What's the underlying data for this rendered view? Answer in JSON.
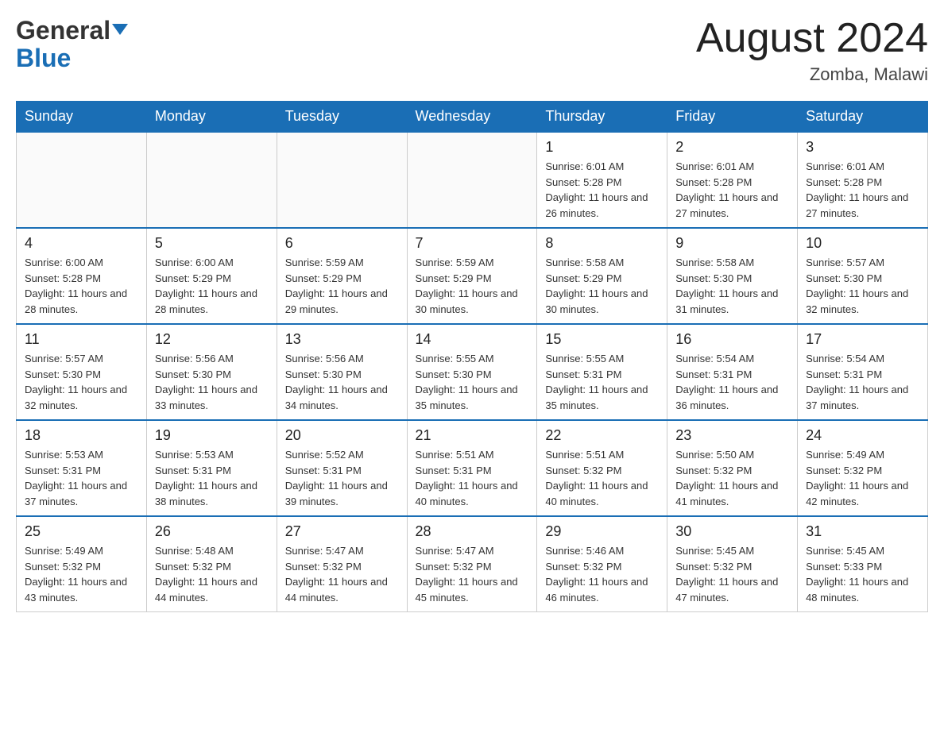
{
  "header": {
    "logo": {
      "general": "General",
      "blue": "Blue",
      "line2": "Blue"
    },
    "title": "August 2024",
    "location": "Zomba, Malawi"
  },
  "weekdays": [
    "Sunday",
    "Monday",
    "Tuesday",
    "Wednesday",
    "Thursday",
    "Friday",
    "Saturday"
  ],
  "weeks": [
    [
      {
        "day": "",
        "info": ""
      },
      {
        "day": "",
        "info": ""
      },
      {
        "day": "",
        "info": ""
      },
      {
        "day": "",
        "info": ""
      },
      {
        "day": "1",
        "info": "Sunrise: 6:01 AM\nSunset: 5:28 PM\nDaylight: 11 hours and 26 minutes."
      },
      {
        "day": "2",
        "info": "Sunrise: 6:01 AM\nSunset: 5:28 PM\nDaylight: 11 hours and 27 minutes."
      },
      {
        "day": "3",
        "info": "Sunrise: 6:01 AM\nSunset: 5:28 PM\nDaylight: 11 hours and 27 minutes."
      }
    ],
    [
      {
        "day": "4",
        "info": "Sunrise: 6:00 AM\nSunset: 5:28 PM\nDaylight: 11 hours and 28 minutes."
      },
      {
        "day": "5",
        "info": "Sunrise: 6:00 AM\nSunset: 5:29 PM\nDaylight: 11 hours and 28 minutes."
      },
      {
        "day": "6",
        "info": "Sunrise: 5:59 AM\nSunset: 5:29 PM\nDaylight: 11 hours and 29 minutes."
      },
      {
        "day": "7",
        "info": "Sunrise: 5:59 AM\nSunset: 5:29 PM\nDaylight: 11 hours and 30 minutes."
      },
      {
        "day": "8",
        "info": "Sunrise: 5:58 AM\nSunset: 5:29 PM\nDaylight: 11 hours and 30 minutes."
      },
      {
        "day": "9",
        "info": "Sunrise: 5:58 AM\nSunset: 5:30 PM\nDaylight: 11 hours and 31 minutes."
      },
      {
        "day": "10",
        "info": "Sunrise: 5:57 AM\nSunset: 5:30 PM\nDaylight: 11 hours and 32 minutes."
      }
    ],
    [
      {
        "day": "11",
        "info": "Sunrise: 5:57 AM\nSunset: 5:30 PM\nDaylight: 11 hours and 32 minutes."
      },
      {
        "day": "12",
        "info": "Sunrise: 5:56 AM\nSunset: 5:30 PM\nDaylight: 11 hours and 33 minutes."
      },
      {
        "day": "13",
        "info": "Sunrise: 5:56 AM\nSunset: 5:30 PM\nDaylight: 11 hours and 34 minutes."
      },
      {
        "day": "14",
        "info": "Sunrise: 5:55 AM\nSunset: 5:30 PM\nDaylight: 11 hours and 35 minutes."
      },
      {
        "day": "15",
        "info": "Sunrise: 5:55 AM\nSunset: 5:31 PM\nDaylight: 11 hours and 35 minutes."
      },
      {
        "day": "16",
        "info": "Sunrise: 5:54 AM\nSunset: 5:31 PM\nDaylight: 11 hours and 36 minutes."
      },
      {
        "day": "17",
        "info": "Sunrise: 5:54 AM\nSunset: 5:31 PM\nDaylight: 11 hours and 37 minutes."
      }
    ],
    [
      {
        "day": "18",
        "info": "Sunrise: 5:53 AM\nSunset: 5:31 PM\nDaylight: 11 hours and 37 minutes."
      },
      {
        "day": "19",
        "info": "Sunrise: 5:53 AM\nSunset: 5:31 PM\nDaylight: 11 hours and 38 minutes."
      },
      {
        "day": "20",
        "info": "Sunrise: 5:52 AM\nSunset: 5:31 PM\nDaylight: 11 hours and 39 minutes."
      },
      {
        "day": "21",
        "info": "Sunrise: 5:51 AM\nSunset: 5:31 PM\nDaylight: 11 hours and 40 minutes."
      },
      {
        "day": "22",
        "info": "Sunrise: 5:51 AM\nSunset: 5:32 PM\nDaylight: 11 hours and 40 minutes."
      },
      {
        "day": "23",
        "info": "Sunrise: 5:50 AM\nSunset: 5:32 PM\nDaylight: 11 hours and 41 minutes."
      },
      {
        "day": "24",
        "info": "Sunrise: 5:49 AM\nSunset: 5:32 PM\nDaylight: 11 hours and 42 minutes."
      }
    ],
    [
      {
        "day": "25",
        "info": "Sunrise: 5:49 AM\nSunset: 5:32 PM\nDaylight: 11 hours and 43 minutes."
      },
      {
        "day": "26",
        "info": "Sunrise: 5:48 AM\nSunset: 5:32 PM\nDaylight: 11 hours and 44 minutes."
      },
      {
        "day": "27",
        "info": "Sunrise: 5:47 AM\nSunset: 5:32 PM\nDaylight: 11 hours and 44 minutes."
      },
      {
        "day": "28",
        "info": "Sunrise: 5:47 AM\nSunset: 5:32 PM\nDaylight: 11 hours and 45 minutes."
      },
      {
        "day": "29",
        "info": "Sunrise: 5:46 AM\nSunset: 5:32 PM\nDaylight: 11 hours and 46 minutes."
      },
      {
        "day": "30",
        "info": "Sunrise: 5:45 AM\nSunset: 5:32 PM\nDaylight: 11 hours and 47 minutes."
      },
      {
        "day": "31",
        "info": "Sunrise: 5:45 AM\nSunset: 5:33 PM\nDaylight: 11 hours and 48 minutes."
      }
    ]
  ]
}
